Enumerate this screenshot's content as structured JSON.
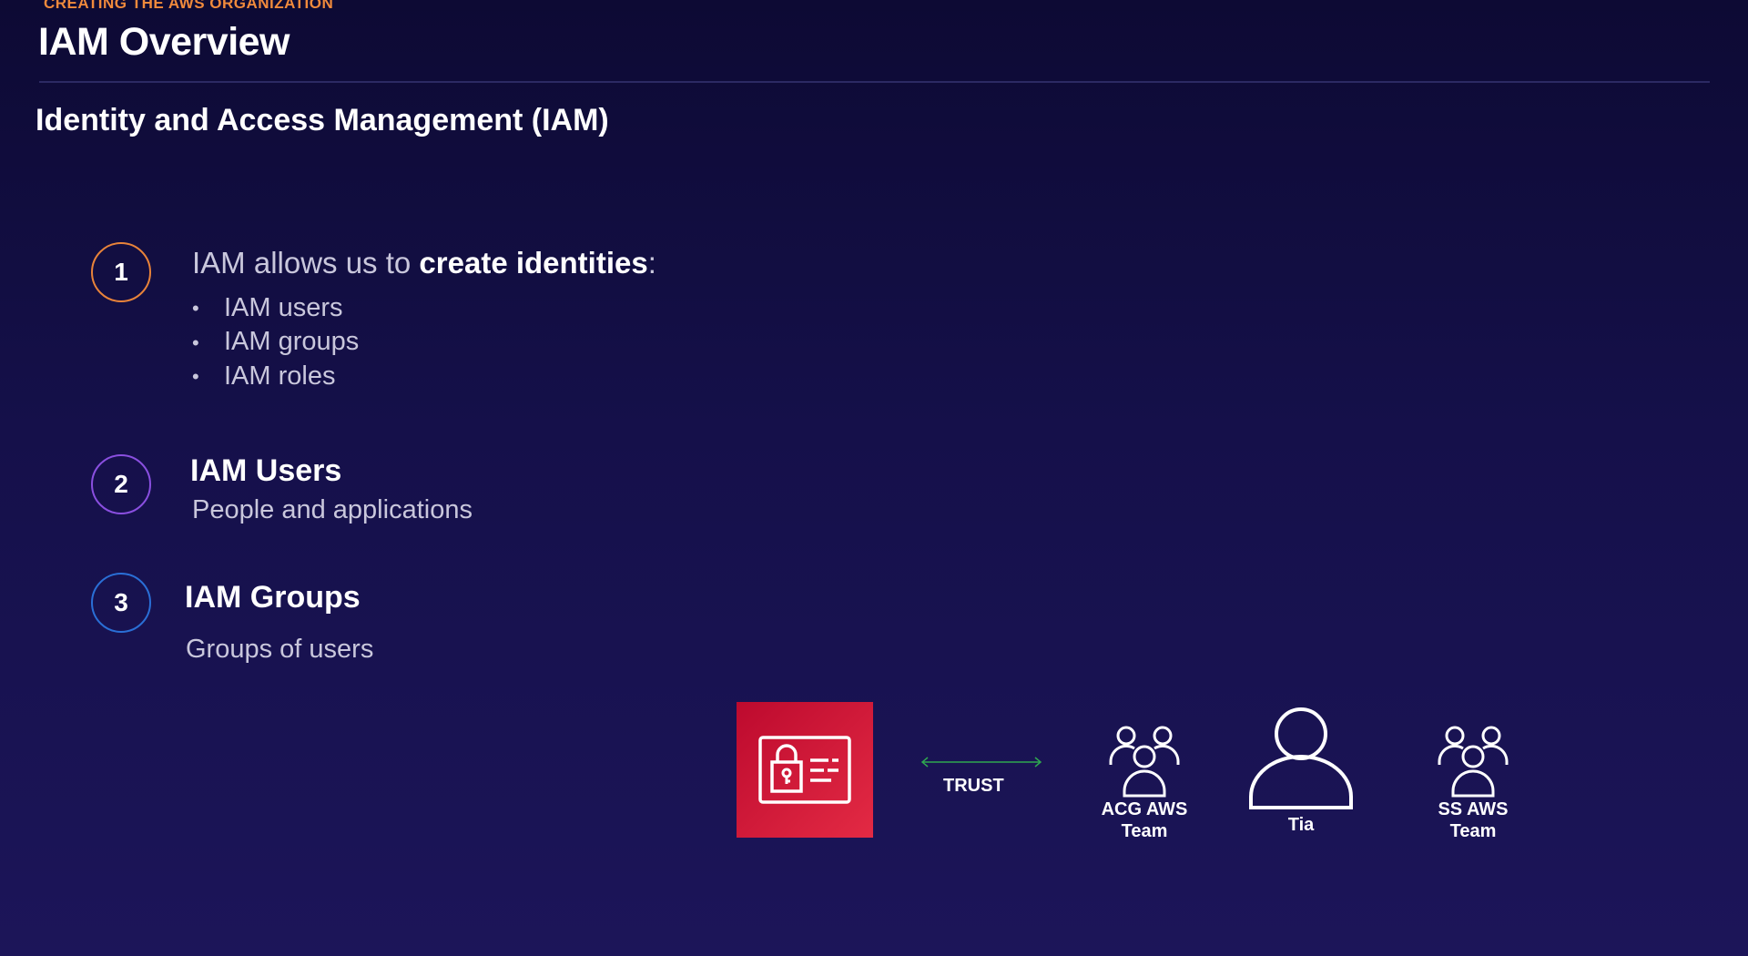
{
  "header": {
    "eyebrow": "CREATING THE AWS ORGANIZATION",
    "title": "IAM Overview",
    "subtitle": "Identity and Access Management (IAM)"
  },
  "steps": [
    {
      "number": "1",
      "color": "#e8833a",
      "intro": "IAM allows us to ",
      "intro_bold": "create identities",
      "intro_suffix": ":",
      "bullets": [
        "IAM users",
        "IAM groups",
        "IAM roles"
      ]
    },
    {
      "number": "2",
      "color": "#8a4fe0",
      "heading": "IAM Users",
      "description": "People and applications"
    },
    {
      "number": "3",
      "color": "#2a6fd6",
      "heading": "IAM Groups",
      "description": "Groups of users"
    }
  ],
  "diagram": {
    "service_icon": "iam-identity-card-icon",
    "service_color": "#d21f3c",
    "trust_label": "TRUST",
    "trust_color": "#2fa84f",
    "entities": [
      {
        "icon": "group-icon",
        "label_line1": "ACG AWS",
        "label_line2": "Team"
      },
      {
        "icon": "user-icon",
        "label_line1": "Tia"
      },
      {
        "icon": "group-icon",
        "label_line1": "SS AWS",
        "label_line2": "Team"
      }
    ]
  }
}
